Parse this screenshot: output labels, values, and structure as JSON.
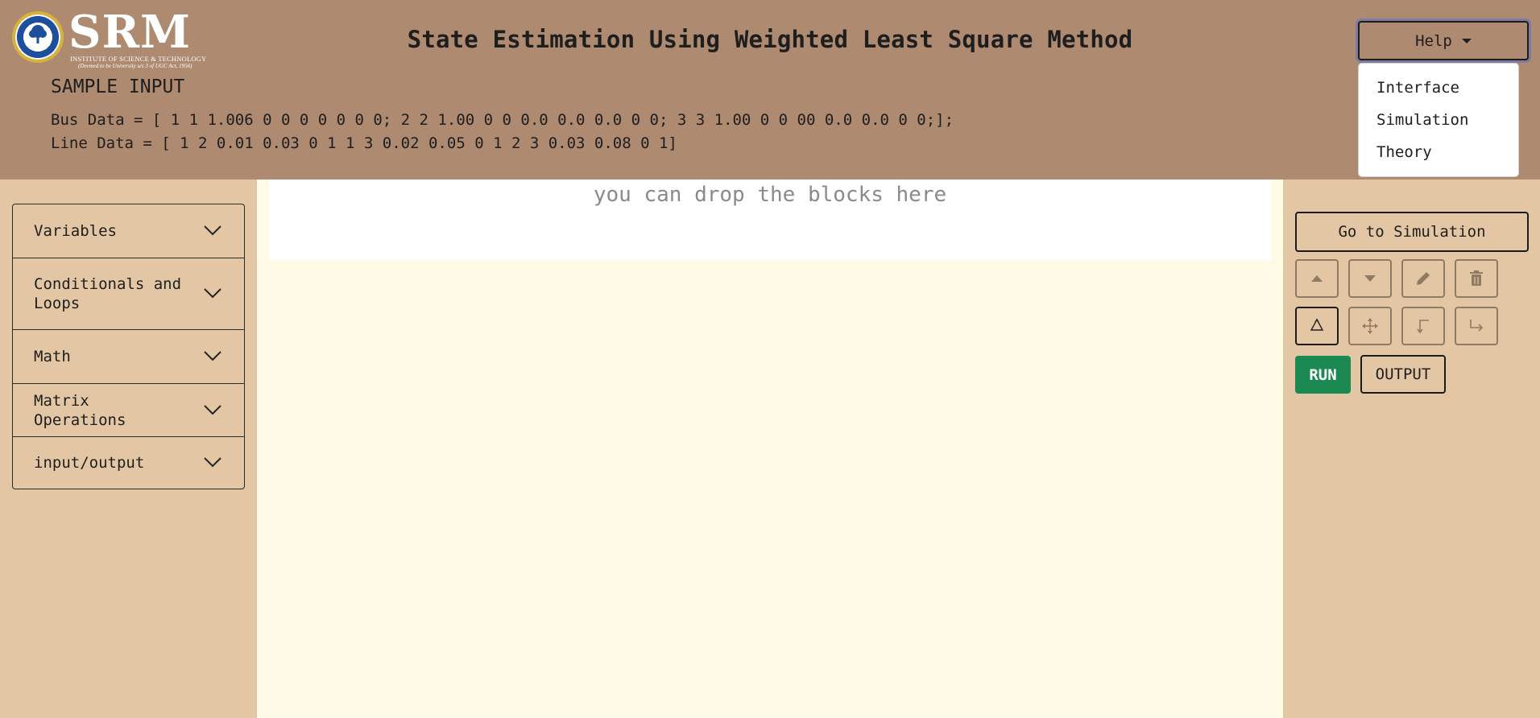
{
  "header": {
    "logo": {
      "text": "SRM",
      "subtitle": "INSTITUTE OF SCIENCE & TECHNOLOGY",
      "tagline": "(Deemed to be University u/s 3 of UGC Act, 1956)"
    },
    "title": "State Estimation Using Weighted Least Square Method",
    "sample": {
      "heading": "SAMPLE INPUT",
      "bus_data": "Bus Data = [ 1 1 1.006 0 0 0 0 0 0 0; 2 2 1.00 0 0 0.0 0.0 0.0 0 0; 3 3 1.00 0 0 00 0.0 0.0 0 0;];",
      "line_data": "Line Data = [ 1 2 0.01 0.03 0 1 1 3 0.02 0.05 0 1 2 3 0.03 0.08 0 1]"
    },
    "help": {
      "label": "Help",
      "items": [
        "Interface",
        "Simulation",
        "Theory"
      ]
    }
  },
  "sidebar": {
    "categories": [
      {
        "label": "Variables"
      },
      {
        "label": "Conditionals and Loops"
      },
      {
        "label": "Math"
      },
      {
        "label": "Matrix Operations"
      },
      {
        "label": "input/output"
      }
    ]
  },
  "workspace": {
    "drop_hint": "you can drop the blocks here"
  },
  "controls": {
    "go_simulation": "Go to Simulation",
    "tools": [
      {
        "icon": "arrow-up-icon"
      },
      {
        "icon": "arrow-down-icon"
      },
      {
        "icon": "pencil-icon"
      },
      {
        "icon": "trash-icon"
      },
      {
        "icon": "recycle-icon"
      },
      {
        "icon": "move-icon"
      },
      {
        "icon": "corner-arrow-icon"
      },
      {
        "icon": "redirect-icon"
      }
    ],
    "run": "RUN",
    "output": "OUTPUT"
  },
  "colors": {
    "header_bg": "#ae8a71",
    "panel_bg": "#e3c7a4",
    "workspace_bg": "#fffae6",
    "run_green": "#1b8a52"
  }
}
